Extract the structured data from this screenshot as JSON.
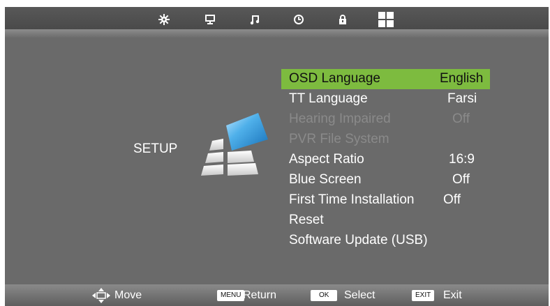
{
  "tabs": [
    {
      "icon": "picture-settings-icon"
    },
    {
      "icon": "monitor-icon"
    },
    {
      "icon": "music-note-icon"
    },
    {
      "icon": "clock-icon"
    },
    {
      "icon": "lock-icon"
    },
    {
      "icon": "grid-icon"
    }
  ],
  "section_label": "SETUP",
  "menu": [
    {
      "label": "OSD Language",
      "value": "English",
      "state": "selected"
    },
    {
      "label": "TT Language",
      "value": "Farsi",
      "state": "normal"
    },
    {
      "label": "Hearing Impaired",
      "value": "Off",
      "state": "disabled"
    },
    {
      "label": "PVR File System",
      "value": "",
      "state": "disabled"
    },
    {
      "label": "Aspect Ratio",
      "value": "16:9",
      "state": "normal"
    },
    {
      "label": "Blue Screen",
      "value": "Off",
      "state": "normal"
    },
    {
      "label": "First Time Installation",
      "value": "Off",
      "state": "normal"
    },
    {
      "label": "Reset",
      "value": "",
      "state": "normal"
    },
    {
      "label": "Software Update (USB)",
      "value": "",
      "state": "normal"
    }
  ],
  "footer": {
    "move_label": "Move",
    "menu_key": "MENU",
    "return_label": "Return",
    "ok_key": "OK",
    "select_label": "Select",
    "exit_key": "EXIT",
    "exit_label": "Exit"
  },
  "colors": {
    "highlight": "#7dbb3f",
    "background": "#6a6a6a",
    "disabled_text": "#8a8a8a"
  }
}
